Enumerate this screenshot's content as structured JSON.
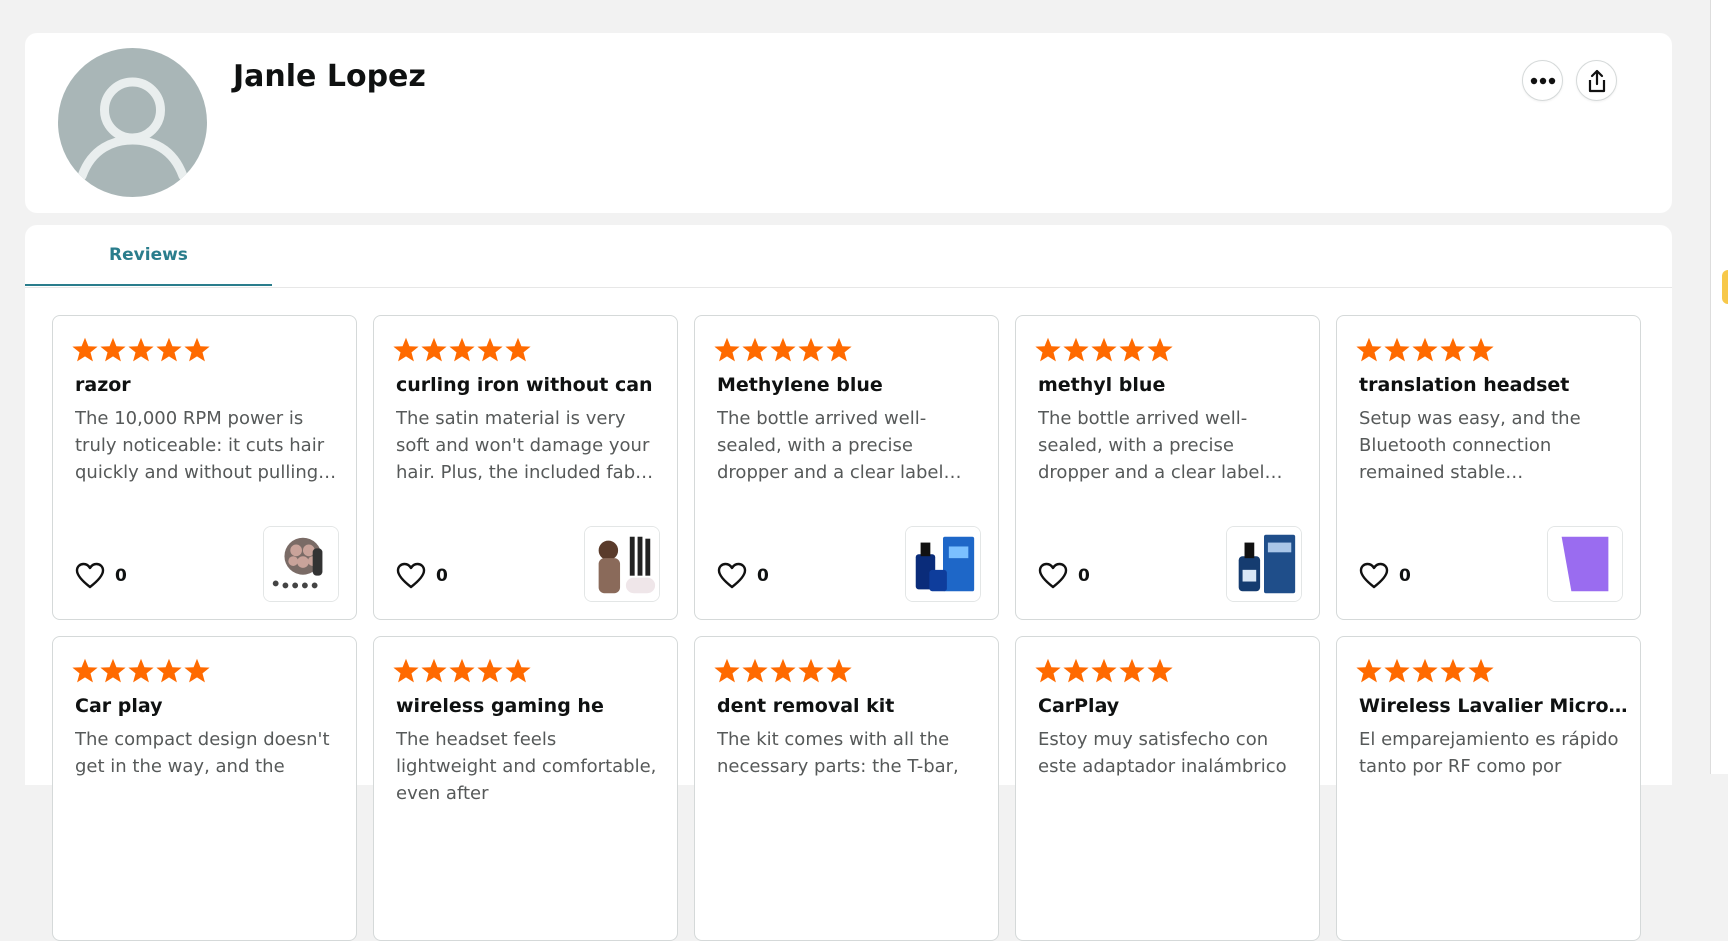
{
  "profile": {
    "name": "Janle Lopez",
    "more_icon": "more-horizontal-icon",
    "share_icon": "share-icon"
  },
  "tabs": [
    {
      "label": "Reviews",
      "active": true
    }
  ],
  "colors": {
    "star": "#ff6a00",
    "accent": "#2a7d8c",
    "avatar_bg": "#a9b6b7"
  },
  "reviews": [
    {
      "rating": 5,
      "title": "razor",
      "body": "The 10,000 RPM power is truly noticeable: it cuts hair quickly and without pulling…",
      "likes": "0",
      "thumb_icon": "razor-product-thumbnail"
    },
    {
      "rating": 5,
      "title": "curling iron without can",
      "body": "The satin material is very soft and won't damage your hair. Plus, the included fabric ba…",
      "likes": "0",
      "thumb_icon": "curling-product-thumbnail"
    },
    {
      "rating": 5,
      "title": "Methylene blue",
      "body": "The bottle arrived well-sealed, with a precise dropper and a clear label…",
      "likes": "0",
      "thumb_icon": "methylene-blue-thumbnail"
    },
    {
      "rating": 5,
      "title": "methyl blue",
      "body": "The bottle arrived well-sealed, with a precise dropper and a clear label…",
      "likes": "0",
      "thumb_icon": "methyl-blue-thumbnail"
    },
    {
      "rating": 5,
      "title": "translation headset",
      "body": "Setup was easy, and the Bluetooth connection remained stable throughou…",
      "likes": "0",
      "thumb_icon": "headset-thumbnail"
    },
    {
      "rating": 5,
      "title": "Car play",
      "body": "The compact design doesn't get in the way, and the",
      "likes": "",
      "thumb_icon": ""
    },
    {
      "rating": 5,
      "title": "wireless gaming he",
      "body": "The headset feels lightweight and comfortable, even after",
      "likes": "",
      "thumb_icon": ""
    },
    {
      "rating": 5,
      "title": "dent removal kit",
      "body": "The kit comes with all the necessary parts: the T-bar,",
      "likes": "",
      "thumb_icon": ""
    },
    {
      "rating": 5,
      "title": "CarPlay",
      "body": "Estoy muy satisfecho con este adaptador inalámbrico",
      "likes": "",
      "thumb_icon": ""
    },
    {
      "rating": 5,
      "title": "Wireless Lavalier Microp…",
      "body": "El emparejamiento es rápido tanto por RF como por",
      "likes": "",
      "thumb_icon": ""
    }
  ]
}
